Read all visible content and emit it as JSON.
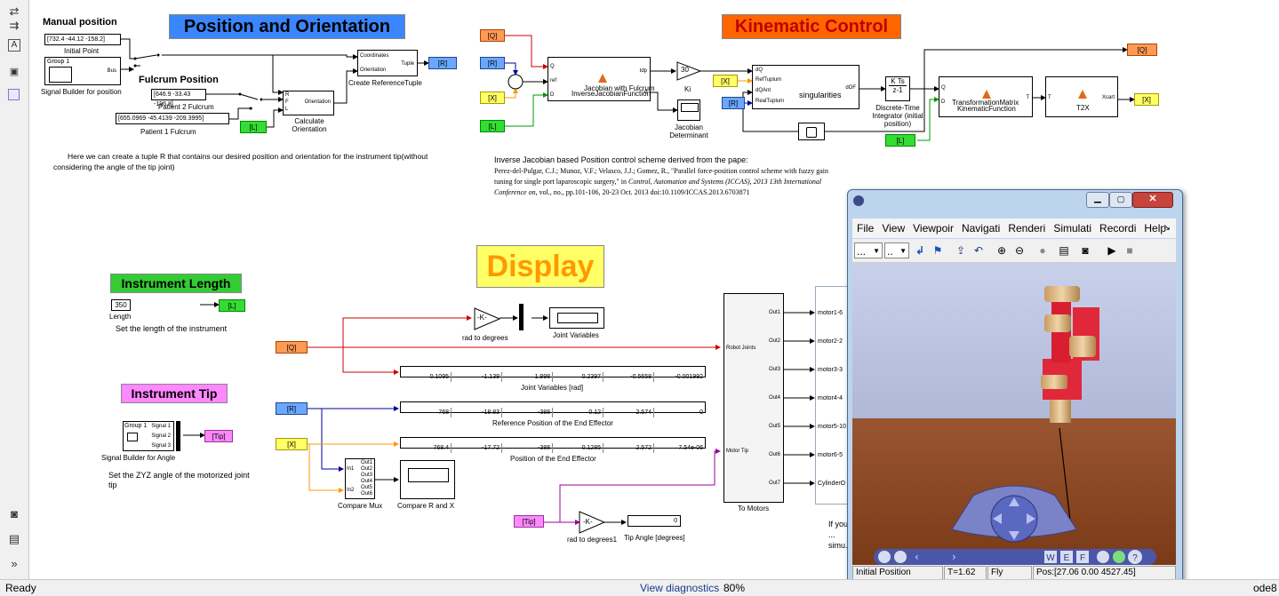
{
  "left_strip": {
    "icons": [
      "arrows-icon",
      "arrow-right-icon",
      "text-box-icon",
      "image-icon",
      "area-icon",
      "camera-icon",
      "report-icon",
      "more-icon"
    ]
  },
  "status": {
    "ready": "Ready",
    "diagnostics": "View diagnostics",
    "zoom": "80%",
    "solver": "ode8"
  },
  "areas": {
    "position": "Position and Orientation",
    "kinematic": "Kinematic Control",
    "display": "Display",
    "length": "Instrument Length",
    "tip": "Instrument Tip"
  },
  "colors": {
    "area_blue": "#3a86ff",
    "area_orange": "#ff6600",
    "area_yellow": "#ffff66",
    "area_green": "#33cc33",
    "area_pink": "#ff88ff",
    "wire_red": "#cc0000",
    "wire_blue": "#000099",
    "wire_orange": "#ff9900",
    "wire_green": "#009900",
    "wire_purple": "#990099"
  },
  "position_area": {
    "manual_position": "Manual position",
    "initial_point_value": "[732.4 -44.12 -158.2]",
    "initial_point_label": "Initial Point",
    "group1": "Group 1",
    "bus": "Bus",
    "signal_builder_label": "Signal Builder for position",
    "fulcrum_position": "Fulcrum Position",
    "patient2_value": "[646.9 -33.43 -196.8]",
    "patient2_label": "Patient 2 Fulcrum",
    "patient1_value": "[655.0969 -45.4139 -209.3995]",
    "patient1_label": "Patient 1 Fulcrum",
    "l_tag": "[L]",
    "orientation": "Orientation",
    "calc_label": "Calculate Orientation",
    "coordinates": "Coordinates",
    "orientation_port": "Orientation",
    "tuple": "Tuple",
    "create_tuple_label": "Create ReferenceTuple",
    "r_tag": "[R]",
    "port_r": "R",
    "port_f": "F",
    "port_l": "L",
    "note": "Here we can create a tuple R that contains our desired position and orientation for the instrument tip(without considering the angle of the tip joint)"
  },
  "kinematic_area": {
    "q_tag": "[Q]",
    "r_tag": "[R]",
    "x_tag": "[X]",
    "l_tag": "[L]",
    "ijac_block": "InverseJacobianFunction",
    "ijac_block_over": "Jacobian with Fulcrum",
    "ijac_tdp": "tdp",
    "ijac_d": "d",
    "port_q": "Q",
    "port_ref": "ref",
    "port_d": "D",
    "gain_value": "30",
    "gain_label": "Ki",
    "det_label": "Jacobian Determinant",
    "sing_block": "singularities",
    "sing_ports": [
      "dQ",
      "RefTuplum",
      "dQAnt",
      "RealTuplum"
    ],
    "sing_out": "dOF",
    "integrator_top": "K Ts",
    "integrator_bottom": "z-1",
    "integrator_label": "Discrete-Time Integrator (initial position)",
    "tmat_block": "KinematicFunction",
    "tmat_block_over": "TransformationMatrix",
    "tmat_port_q": "Q",
    "tmat_port_d": "D",
    "tmat_out": "T",
    "t2x_block": "T2X",
    "t2x_in": "T",
    "t2x_out": "Xcart",
    "q_out_tag": "[Q]",
    "x_out_tag": "[X]",
    "ref_title": "Inverse Jacobian based Position control scheme derived from the pape:",
    "ref_authors": "Perez-del-Pulgar, C.J.; Munoz, V.F.; Velasco, J.J.; Gomez, R., \"Parallel force-position control scheme with fuzzy gain tuning for single port laparoscopic surgery,\" in ",
    "ref_venue": "Control, Automation and Systems (ICCAS), 2013 13th International Conference on",
    "ref_tail": ", vol., no., pp.101-106, 20-23 Oct. 2013 doi:10.1109/ICCAS.2013.6703871"
  },
  "length_area": {
    "value": "350",
    "label": "Length",
    "tag": "[L]",
    "note": "Set the length of the instrument"
  },
  "tip_area": {
    "group1": "Group 1",
    "signal1": "Signal 1",
    "signal2": "Signal 2",
    "signal3": "Signal 3",
    "label": "Signal Builder for Angle",
    "tag": "[Tip]",
    "note": "Set the ZYZ angle of the motorized joint tip"
  },
  "display_area": {
    "gain": "-K-",
    "rad_label": "rad to degrees",
    "joint_scope_label": "Joint Variables",
    "q_tag": "[Q]",
    "r_tag": "[R]",
    "x_tag": "[X]",
    "tip_tag": "[Tip]",
    "joint_values": [
      "0.1095",
      "-1.139",
      "1.998",
      "0.2397",
      "-0.5658",
      "-0.001992"
    ],
    "joint_label": "Joint Variables [rad]",
    "ref_values": [
      "768",
      "-18.83",
      "-388",
      "0.12",
      "2.574",
      "0"
    ],
    "ref_label": "Reference Position of the End Effector",
    "pos_values": [
      "768.4",
      "-17.72",
      "-388",
      "0.1285",
      "2.572",
      "7.54e-06"
    ],
    "pos_label": "Position of the End Effector",
    "mux_in": [
      "In1",
      "In2"
    ],
    "mux_out": [
      "Out1",
      "Out2",
      "Out3",
      "Out4",
      "Out5",
      "Out6"
    ],
    "mux_label": "Compare Mux",
    "compare_label": "Compare R and X",
    "tip_gain": "-K-",
    "tip_rad_label": "rad to degrees1",
    "tip_value": "0",
    "tip_display_label": "Tip Angle [degrees]",
    "tomotors_ports_in": [
      "Robot Joints",
      "Motor Tip"
    ],
    "tomotors_ports_out": [
      "Out1",
      "Out2",
      "Out3",
      "Out4",
      "Out5",
      "Out6",
      "Out7"
    ],
    "tomotors_label": "To Motors",
    "motor_lines": [
      "motor1-6",
      "motor2-2",
      "motor3-3",
      "motor4-4",
      "motor5-10",
      "motor6-5",
      "CylinderO"
    ],
    "hidden_note": "If you ... simu..."
  },
  "vr_window": {
    "menu": [
      "File",
      "View",
      "Viewpoir",
      "Navigati",
      "Renderi",
      "Simulati",
      "Recordi",
      "Help"
    ],
    "toolbar_combo1": "...",
    "toolbar_combo2": "..",
    "status_view": "Initial Position",
    "status_time": "T=1.62",
    "status_mode": "Fly",
    "status_pos": "Pos:[27.06 0.00 4527.45]"
  }
}
